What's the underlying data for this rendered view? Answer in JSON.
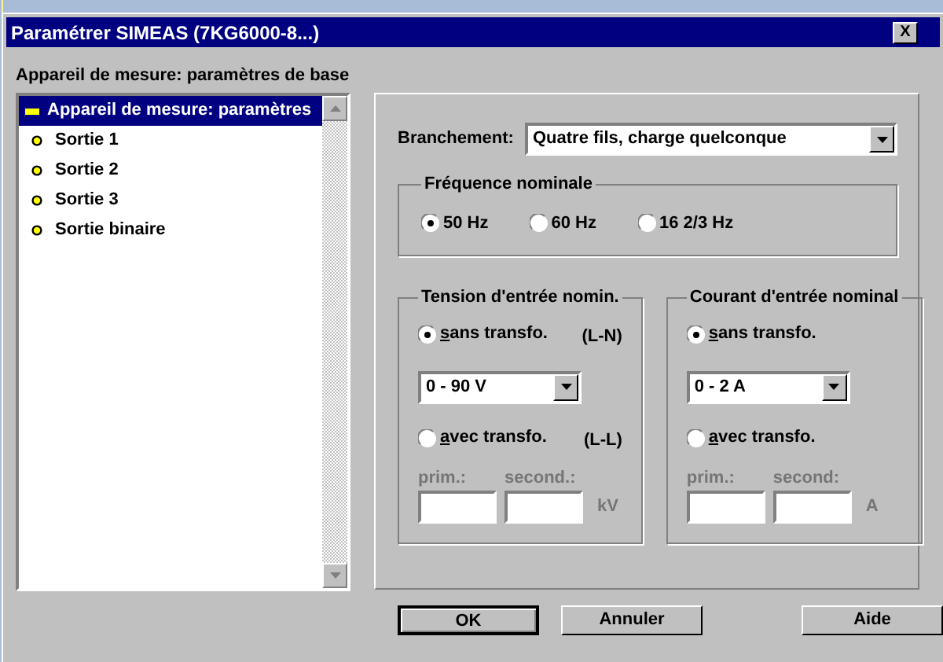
{
  "window": {
    "title": "Paramétrer SIMEAS (7KG6000-8...)",
    "close": "X"
  },
  "heading": "Appareil de mesure: paramètres de base",
  "tree": {
    "items": [
      {
        "label": "Appareil de mesure: paramètres",
        "selected": true,
        "kind": "dash"
      },
      {
        "label": "Sortie 1",
        "selected": false,
        "kind": "dot"
      },
      {
        "label": "Sortie 2",
        "selected": false,
        "kind": "dot"
      },
      {
        "label": "Sortie 3",
        "selected": false,
        "kind": "dot"
      },
      {
        "label": "Sortie binaire",
        "selected": false,
        "kind": "dot"
      }
    ]
  },
  "branchement": {
    "label": "Branchement:",
    "value": "Quatre fils, charge quelconque"
  },
  "frequence": {
    "title": "Fréquence nominale",
    "options": [
      {
        "label": "50 Hz",
        "selected": true
      },
      {
        "label": "60 Hz",
        "selected": false
      },
      {
        "label": "16 2/3 Hz",
        "selected": false
      }
    ]
  },
  "groups": [
    {
      "title": "Tension d'entrée nomin.",
      "without": {
        "label": "sans transfo.",
        "note": "(L-N)",
        "selected": true
      },
      "range": "0 - 90 V",
      "with": {
        "label": "avec transfo.",
        "note": "(L-L)",
        "selected": false
      },
      "transfo": {
        "disabled": true,
        "prim": "prim.:",
        "second": "second.:",
        "unit": "kV"
      }
    },
    {
      "title": "Courant d'entrée nominal",
      "without": {
        "label": "sans transfo.",
        "selected": true
      },
      "range": "0 - 2 A",
      "with": {
        "label": "avec transfo.",
        "selected": false
      },
      "transfo": {
        "disabled": true,
        "prim": "prim.:",
        "second": "second:",
        "unit": "A"
      }
    }
  ],
  "buttons": [
    {
      "label": "OK",
      "default": true
    },
    {
      "label": "Annuler",
      "default": false
    },
    {
      "label": "Aide",
      "default": false
    }
  ]
}
